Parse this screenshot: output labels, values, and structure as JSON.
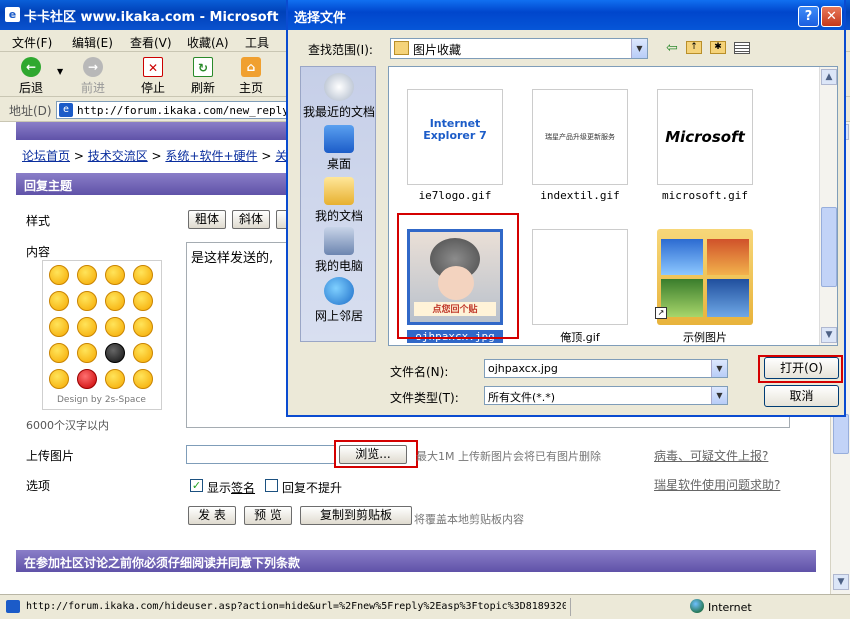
{
  "ie_window": {
    "title": "卡卡社区 www.ikaka.com - Microsoft",
    "menu": [
      "文件(F)",
      "编辑(E)",
      "查看(V)",
      "收藏(A)",
      "工具"
    ],
    "toolbar": {
      "back": "后退",
      "forward": "前进",
      "stop": "停止",
      "refresh": "刷新",
      "home": "主页"
    },
    "address_label": "地址(D)",
    "address_url": "http://forum.ikaka.com/new_reply.a",
    "status_url": "http://forum.ikaka.com/hideuser.asp?action=hide&url=%2Fnew%5Freply%2Easp%3Ftopic%3D8189320",
    "status_zone": "Internet"
  },
  "forum": {
    "breadcrumb": [
      "论坛首页",
      "技术交流区",
      "系统+软件+硬件",
      "关于"
    ],
    "reply_header": "回复主题",
    "style_label": "样式",
    "bold_button": "粗体",
    "italic_button": "斜体",
    "content_label": "内容",
    "content_text": "是这样发送的,",
    "emoji_credit": "Design by 2s-Space",
    "char_limit": "6000个汉字以内",
    "upload_label": "上传图片",
    "browse_button": "浏览...",
    "upload_hint": "最大1M 上传新图片会将已有图片删除",
    "virus_report_link": "病毒、可疑文件上报?",
    "options_label": "选项",
    "show_signature_label": "显示签名",
    "signature_link": "签名",
    "no_bump_label": "回复不提升",
    "usage_help_link": "瑞星软件使用问题求助?",
    "submit_button": "发 表",
    "preview_button": "预 览",
    "copy_clipboard_button": "复制到剪贴板",
    "clipboard_hint": "将覆盖本地剪贴板内容",
    "terms_header": "在参加社区讨论之前你必须仔细阅读并同意下列条款"
  },
  "dialog": {
    "title": "选择文件",
    "look_in_label": "查找范围(I):",
    "look_in_value": "图片收藏",
    "places": [
      "我最近的文档",
      "桌面",
      "我的文档",
      "我的电脑",
      "网上邻居"
    ],
    "files": [
      {
        "name": "ie7logo.gif",
        "thumb_text": "Internet Explorer 7"
      },
      {
        "name": "indextil.gif",
        "thumb_text": "瑞星产品升级更新服务"
      },
      {
        "name": "microsoft.gif",
        "thumb_text": "Microsoft"
      },
      {
        "name": "ojhpaxcx.jpg",
        "thumb_text": "点您回个贴"
      },
      {
        "name": "俺顶.gif",
        "thumb_text": ""
      },
      {
        "name": "示例图片",
        "thumb_text": ""
      }
    ],
    "filename_label": "文件名(N):",
    "filename_value": "ojhpaxcx.jpg",
    "filetype_label": "文件类型(T):",
    "filetype_value": "所有文件(*.*)",
    "open_button": "打开(O)",
    "cancel_button": "取消"
  },
  "colors": {
    "xp_blue": "#0a52cf",
    "forum_purple": "#6f63b6",
    "highlight_red": "#d40000"
  }
}
